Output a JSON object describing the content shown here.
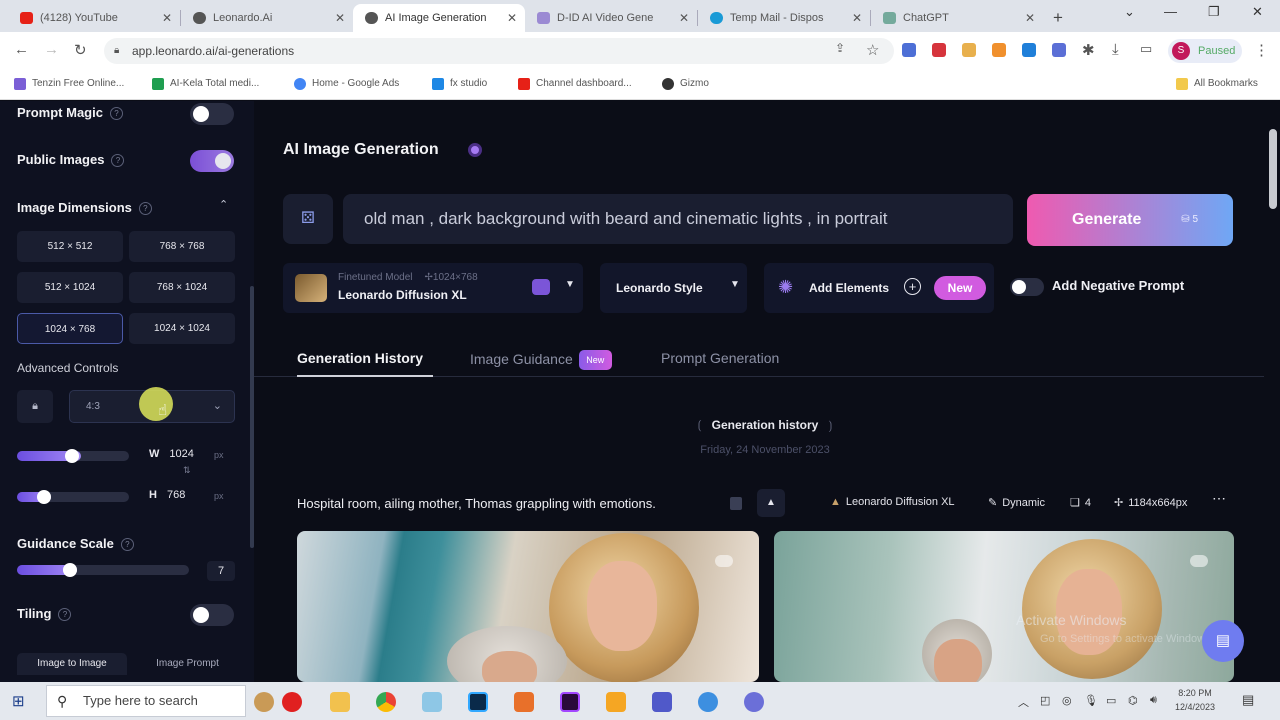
{
  "browser": {
    "tabs": [
      {
        "title": "(4128) YouTube",
        "color": "#e62117"
      },
      {
        "title": "Leonardo.Ai",
        "color": "#555"
      },
      {
        "title": "AI Image Generation",
        "color": "#555"
      },
      {
        "title": "D-ID AI Video Gene",
        "color": "#9b8ad3"
      },
      {
        "title": "Temp Mail - Dispos",
        "color": "#1a9ad6"
      },
      {
        "title": "ChatGPT",
        "color": "#74aa9c"
      }
    ],
    "url": "app.leonardo.ai/ai-generations",
    "profile_initial": "S",
    "profile_status": "Paused",
    "bookmarks": [
      {
        "label": "Tenzin Free Online...",
        "color": "#7b5fd6"
      },
      {
        "label": "AI-Kela Total medi...",
        "color": "#1f9e50"
      },
      {
        "label": "Home - Google Ads",
        "color": "#4285f4"
      },
      {
        "label": "fx studio",
        "color": "#1e88e5"
      },
      {
        "label": "Channel dashboard...",
        "color": "#e62117"
      },
      {
        "label": "Gizmo",
        "color": "#333"
      }
    ],
    "all_bookmarks": "All Bookmarks"
  },
  "sidebar": {
    "prompt_magic": "Prompt Magic",
    "public_images": "Public Images",
    "image_dimensions": "Image Dimensions",
    "dimensions": [
      "512 × 512",
      "768 × 768",
      "512 × 1024",
      "768 × 1024",
      "1024 × 768",
      "1024 × 1024"
    ],
    "selected_dimension": "1024 × 768",
    "advanced_controls": "Advanced Controls",
    "aspect_ratio": "4:3",
    "width_label": "W",
    "width_value": "1024",
    "height_label": "H",
    "height_value": "768",
    "px_unit": "px",
    "guidance_scale": "Guidance Scale",
    "guidance_value": "7",
    "tiling": "Tiling",
    "bottom_tabs": [
      "Image to Image",
      "Image Prompt"
    ]
  },
  "main": {
    "title": "AI Image Generation",
    "prompt": "old man , dark background with beard and cinematic lights , in portrait",
    "generate_label": "Generate",
    "generate_cost": "5",
    "model_caption": "Finetuned Model",
    "model_resolution": "1024×768",
    "model_name": "Leonardo Diffusion XL",
    "style_label": "Leonardo Style",
    "add_elements": "Add Elements",
    "new_badge": "New",
    "add_negative_prompt": "Add Negative Prompt",
    "tabs": [
      "Generation History",
      "Image Guidance",
      "Prompt Generation"
    ],
    "tab_new_badge": "New",
    "history_title": "Generation history",
    "history_date": "Friday, 24 November 2023",
    "generation": {
      "prompt": "Hospital room, ailing mother, Thomas grappling with emotions.",
      "model": "Leonardo Diffusion XL",
      "style": "Dynamic",
      "count": "4",
      "size": "1184x664px"
    },
    "watermark_line1": "Activate Windows",
    "watermark_line2": "Go to Settings to activate Windows."
  },
  "taskbar": {
    "search_placeholder": "Type here to search",
    "time": "8:20 PM",
    "date": "12/4/2023"
  }
}
